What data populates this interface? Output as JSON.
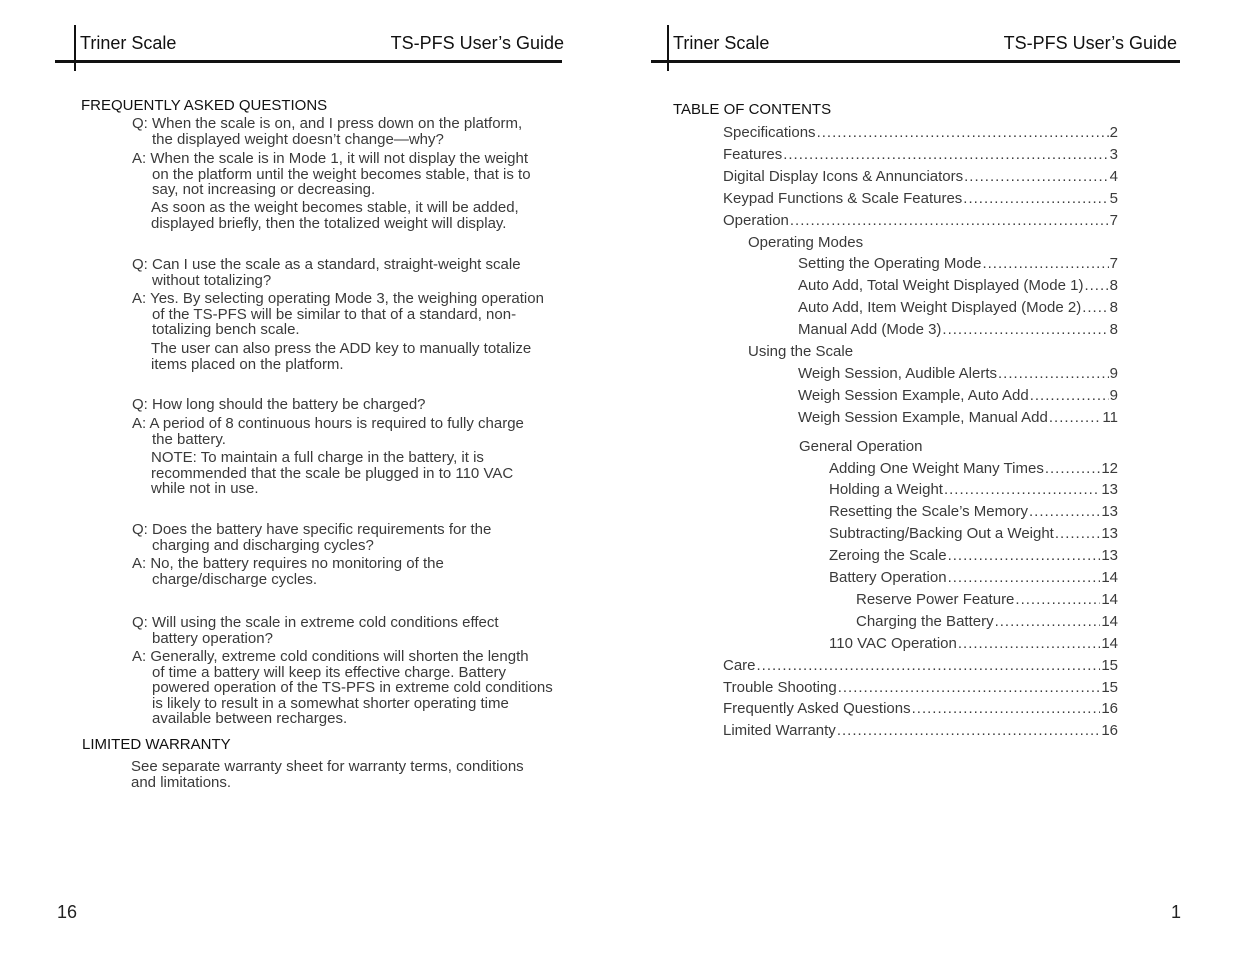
{
  "left_page": {
    "header": {
      "left": "Triner Scale",
      "right": "TS-PFS User’s Guide"
    },
    "faq_heading": "FREQUENTLY ASKED QUESTIONS",
    "faq": [
      {
        "q": [
          "Q: When the scale is on, and I press down on the platform,",
          "the displayed weight doesn’t change—why?"
        ],
        "a": [
          "A: When the scale is in Mode 1, it will not display the weight",
          "on the platform until the weight becomes stable, that is to",
          "say, not increasing or decreasing."
        ],
        "extra": [
          "As soon as the weight becomes stable, it will be added,",
          "displayed briefly, then the totalized weight will display."
        ]
      },
      {
        "q": [
          "Q: Can I use the scale as a standard, straight-weight scale",
          "without totalizing?"
        ],
        "a": [
          "A: Yes. By selecting operating Mode 3, the weighing operation",
          "of the TS-PFS will be similar to that of a standard, non-",
          "totalizing bench scale."
        ],
        "extra": [
          "The user can also press the ADD key to manually totalize",
          "items placed on the platform."
        ]
      },
      {
        "q": [
          "Q: How long should the battery be charged?"
        ],
        "a": [
          "A: A period of 8 continuous hours is required to fully charge",
          "the battery."
        ],
        "extra": [
          "NOTE: To maintain a full charge in the battery, it is",
          "recommended that the scale be plugged in to 110 VAC",
          "while not in use."
        ]
      },
      {
        "q": [
          "Q: Does the battery have specific requirements for the",
          "charging and discharging cycles?"
        ],
        "a": [
          "A: No, the battery requires no monitoring of the",
          "charge/discharge cycles."
        ]
      },
      {
        "q": [
          "Q: Will using the scale in extreme cold conditions effect",
          "battery operation?"
        ],
        "a": [
          "A: Generally, extreme cold conditions will shorten the length",
          "of time a battery will keep its effective charge. Battery",
          "powered operation of the TS-PFS in extreme cold conditions",
          "is likely to result in a somewhat shorter operating time",
          "available between recharges."
        ]
      }
    ],
    "warranty_heading": "LIMITED WARRANTY",
    "warranty_text": [
      "See separate warranty sheet for warranty terms, conditions",
      "and limitations."
    ],
    "page_number": "16"
  },
  "right_page": {
    "header": {
      "left": "Triner Scale",
      "right": "TS-PFS User’s Guide"
    },
    "toc_title": "TABLE OF CONTENTS",
    "toc": [
      {
        "label": "Specifications",
        "page": "2",
        "level": 0
      },
      {
        "label": "Features",
        "page": "3",
        "level": 0
      },
      {
        "label": "Digital Display Icons & Annunciators",
        "page": "4",
        "level": 0
      },
      {
        "label": "Keypad Functions & Scale Features",
        "page": "5",
        "level": 0
      },
      {
        "label": "Operation",
        "page": "7",
        "level": 0
      },
      {
        "label": "Operating Modes",
        "page": "",
        "level": 1
      },
      {
        "label": "Setting the Operating Mode",
        "page": "7",
        "level": 2
      },
      {
        "label": "Auto Add, Total Weight Displayed (Mode 1)",
        "page": "8",
        "level": 2
      },
      {
        "label": "Auto Add, Item Weight Displayed (Mode 2)",
        "page": "8",
        "level": 2
      },
      {
        "label": "Manual Add (Mode 3)",
        "page": "8",
        "level": 2
      },
      {
        "label": "Using the Scale",
        "page": "",
        "level": 1
      },
      {
        "label": "Weigh Session, Audible Alerts",
        "page": "9",
        "level": 2
      },
      {
        "label": "Weigh Session Example, Auto Add",
        "page": "9",
        "level": 2
      },
      {
        "label": "Weigh Session Example, Manual Add",
        "page": "11",
        "level": 2
      },
      {
        "label": "General Operation",
        "page": "",
        "level": 2
      },
      {
        "label": "Adding One Weight Many Times",
        "page": "12",
        "level": 3
      },
      {
        "label": "Holding a Weight",
        "page": "13",
        "level": 3
      },
      {
        "label": "Resetting the Scale’s Memory",
        "page": "13",
        "level": 3
      },
      {
        "label": "Subtracting/Backing Out a Weight",
        "page": "13",
        "level": 3
      },
      {
        "label": "Zeroing the Scale",
        "page": "13",
        "level": 3
      },
      {
        "label": "Battery Operation",
        "page": "14",
        "level": 3
      },
      {
        "label": "Reserve Power Feature",
        "page": "14",
        "level": 4
      },
      {
        "label": "Charging the Battery",
        "page": "14",
        "level": 4
      },
      {
        "label": "110 VAC Operation",
        "page": "14",
        "level": 3
      },
      {
        "label": "Care",
        "page": "15",
        "level": 0
      },
      {
        "label": "Trouble Shooting",
        "page": "15",
        "level": 0
      },
      {
        "label": "Frequently Asked Questions",
        "page": "16",
        "level": 0
      },
      {
        "label": "Limited Warranty",
        "page": "16",
        "level": 0
      }
    ],
    "page_number": "1"
  }
}
